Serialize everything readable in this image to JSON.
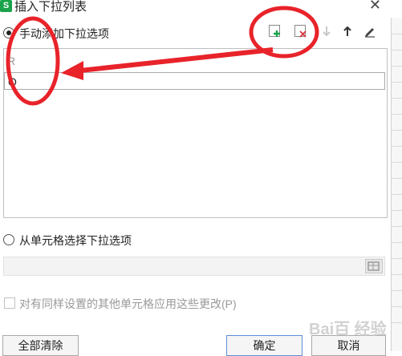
{
  "window": {
    "app_icon_letter": "S",
    "title": "插入下拉列表",
    "close_glyph": "✕"
  },
  "manual_option": {
    "label": "手动添加下拉选项",
    "selected": true
  },
  "toolbar": {
    "icons": [
      "add-item-icon",
      "delete-item-icon",
      "move-down-icon",
      "move-up-icon",
      "edit-icon"
    ],
    "add_color": "#1aa34a",
    "delete_color": "#d9363e"
  },
  "list": {
    "items": [
      {
        "text": "R",
        "state": "muted"
      },
      {
        "text": "Q",
        "state": "selected"
      }
    ]
  },
  "cell_option": {
    "label": "从单元格选择下拉选项",
    "selected": false
  },
  "apply_option": {
    "label": "对有同样设置的其他单元格应用这些更改(P)",
    "checked": false
  },
  "buttons": {
    "clear_all": "全部清除",
    "ok": "确定",
    "cancel": "取消"
  },
  "annotation_color": "#e8232a",
  "watermark": "Bai百 经验"
}
